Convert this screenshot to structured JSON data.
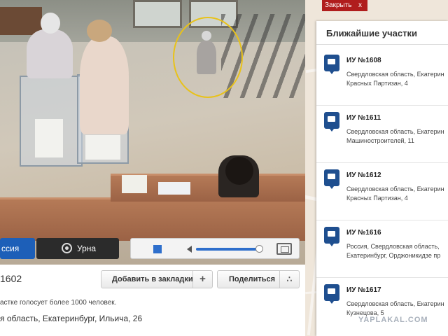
{
  "video": {
    "tabs": {
      "russia": "ссия",
      "urn": "Урна"
    }
  },
  "info": {
    "station_title": "1602",
    "bookmark_label": "Добавить в закладки",
    "bookmark_plus": "+",
    "share_label": "Поделиться",
    "note": "астке голосует более 1000 человек.",
    "address": "я область, Екатеринбург, Ильича, 26"
  },
  "close_button": {
    "label": "Закрыть",
    "x": "x"
  },
  "nearest": {
    "title": "Ближайшие участки",
    "items": [
      {
        "name": "ИУ №1608",
        "address_line1": "Свердловская область, Екатерин",
        "address_line2": "Красных Партизан, 4"
      },
      {
        "name": "ИУ №1611",
        "address_line1": "Свердловская область, Екатерин",
        "address_line2": "Машиностроителей, 11"
      },
      {
        "name": "ИУ №1612",
        "address_line1": "Свердловская область, Екатерин",
        "address_line2": "Красных Партизан, 4"
      },
      {
        "name": "ИУ №1616",
        "address_line1": "Россия, Свердловская область,",
        "address_line2": "Екатеринбург, Орджоникидзе пр"
      },
      {
        "name": "ИУ №1617",
        "address_line1": "Свердловская область, Екатерин",
        "address_line2": "Кузнецова, 5"
      }
    ]
  },
  "watermark": "YAPLAKAL.COM",
  "colors": {
    "accent_blue": "#1d5fb8",
    "close_red": "#b01d1d",
    "pin_blue": "#1f4f8f",
    "highlight_circle": "#e8c21a"
  }
}
